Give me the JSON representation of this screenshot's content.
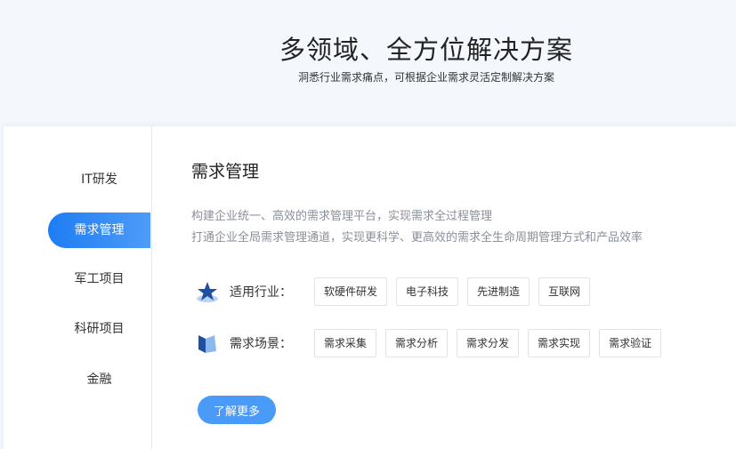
{
  "hero": {
    "title": "多领域、全方位解决方案",
    "subtitle": "洞悉行业需求痛点，可根据企业需求灵活定制解决方案"
  },
  "sidebar": {
    "items": [
      {
        "label": "IT研发",
        "active": false
      },
      {
        "label": "需求管理",
        "active": true
      },
      {
        "label": "军工项目",
        "active": false
      },
      {
        "label": "科研项目",
        "active": false
      },
      {
        "label": "金融",
        "active": false
      }
    ]
  },
  "section": {
    "title": "需求管理",
    "desc_line1": "构建企业统一、高效的需求管理平台，实现需求全过程管理",
    "desc_line2": "打通企业全局需求管理通道，实现更科学、更高效的需求全生命周期管理方式和产品效率",
    "industries": {
      "icon": "star-icon",
      "label": "适用行业：",
      "tags": [
        "软硬件研发",
        "电子科技",
        "先进制造",
        "互联网"
      ]
    },
    "scenes": {
      "icon": "flag-icon",
      "label": "需求场景：",
      "tags": [
        "需求采集",
        "需求分析",
        "需求分发",
        "需求实现",
        "需求验证"
      ]
    },
    "more_label": "了解更多"
  },
  "colors": {
    "accent": "#1e7cf3",
    "button": "#4a9af7"
  }
}
